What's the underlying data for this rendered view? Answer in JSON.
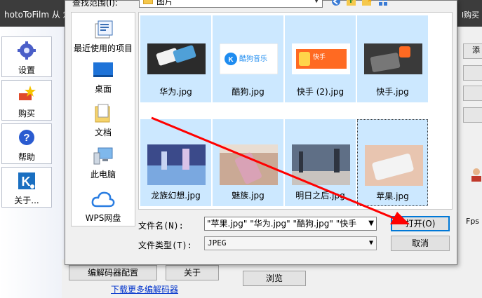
{
  "app": {
    "title": "hotoToFilm  从 您",
    "title_right": "l购买",
    "sidebar": [
      {
        "label": "设置",
        "icon": "gear-icon"
      },
      {
        "label": "购买",
        "icon": "cart-star-icon"
      },
      {
        "label": "帮助",
        "icon": "help-icon"
      },
      {
        "label": "关于...",
        "icon": "k-logo-icon"
      }
    ],
    "codec_button": "编解码器配置",
    "about_button": "关于",
    "browse_button": "浏览",
    "download_link": "下载更多编解码器",
    "fps_label": "Fps",
    "right_partial_label": "添"
  },
  "dialog": {
    "look_in_label": "查找范围(I):",
    "look_in_value": "图片",
    "places": [
      {
        "label": "最近使用的项目",
        "icon": "recent-items-icon"
      },
      {
        "label": "桌面",
        "icon": "desktop-icon"
      },
      {
        "label": "文档",
        "icon": "documents-icon"
      },
      {
        "label": "此电脑",
        "icon": "computer-icon"
      },
      {
        "label": "WPS网盘",
        "icon": "cloud-icon"
      }
    ],
    "files": [
      {
        "name": "华为.jpg"
      },
      {
        "name": "酷狗.jpg",
        "thumb_text": "酷狗音乐"
      },
      {
        "name": "快手 (2).jpg",
        "thumb_text": "快手"
      },
      {
        "name": "快手.jpg"
      },
      {
        "name": "龙族幻想.jpg"
      },
      {
        "name": "魅族.jpg"
      },
      {
        "name": "明日之后.jpg"
      },
      {
        "name": "苹果.jpg"
      }
    ],
    "filename_label": "文件名(N):",
    "filename_value": "\"苹果.jpg\" \"华为.jpg\" \"酷狗.jpg\" \"快手",
    "filetype_label": "文件类型(T):",
    "filetype_value": "JPEG",
    "open_button": "打开(O)",
    "cancel_button": "取消"
  },
  "colors": {
    "selection": "#cce8ff",
    "arrow": "#ff0000",
    "titlebar": "#3c3c3c"
  }
}
